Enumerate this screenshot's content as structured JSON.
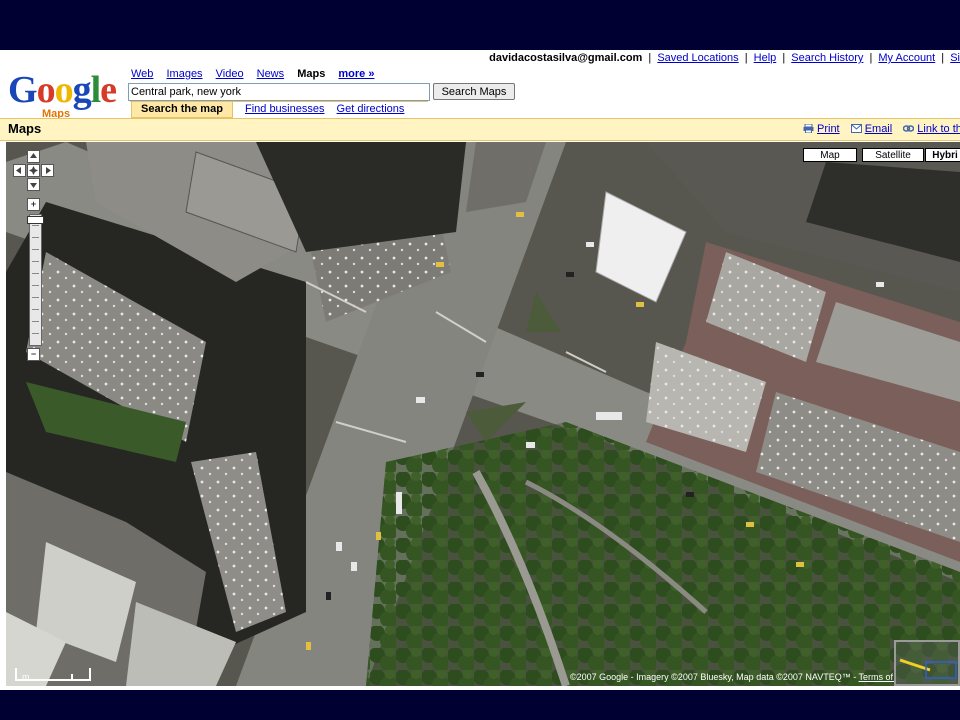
{
  "logo": {
    "word": "Google",
    "sub": "Maps"
  },
  "nav": {
    "web": "Web",
    "images": "Images",
    "video": "Video",
    "news": "News",
    "maps": "Maps",
    "more": "more »"
  },
  "account": {
    "email": "davidacostasilva@gmail.com",
    "saved_locations": "Saved Locations",
    "help": "Help",
    "search_history": "Search History",
    "my_account": "My Account",
    "sign_out": "Si",
    "separator": "|"
  },
  "search": {
    "value": "Central park, new york",
    "button": "Search Maps",
    "tab_search": "Search the map",
    "tab_businesses": "Find businesses",
    "tab_directions": "Get directions"
  },
  "title_bar": {
    "title": "Maps",
    "print": "Print",
    "email": "Email",
    "link": "Link to this"
  },
  "map": {
    "types": {
      "map": "Map",
      "satellite": "Satellite",
      "hybrid": "Hybri"
    },
    "zoom_in": "+",
    "zoom_out": "−",
    "zoom_level_fraction": 0.98,
    "copyright": "©2007 Google - Imagery ©2007 Bluesky, Map data ©2007 NAVTEQ™ -",
    "terms": "Terms of Use",
    "scale_label": "m"
  },
  "colors": {
    "google_blue": "#1a47b8",
    "google_red": "#d63a28",
    "google_yellow": "#efb800",
    "google_green": "#2e8b3a",
    "link": "#0000cc",
    "title_bar": "#fff4c2",
    "slide_bg": "#000033"
  }
}
